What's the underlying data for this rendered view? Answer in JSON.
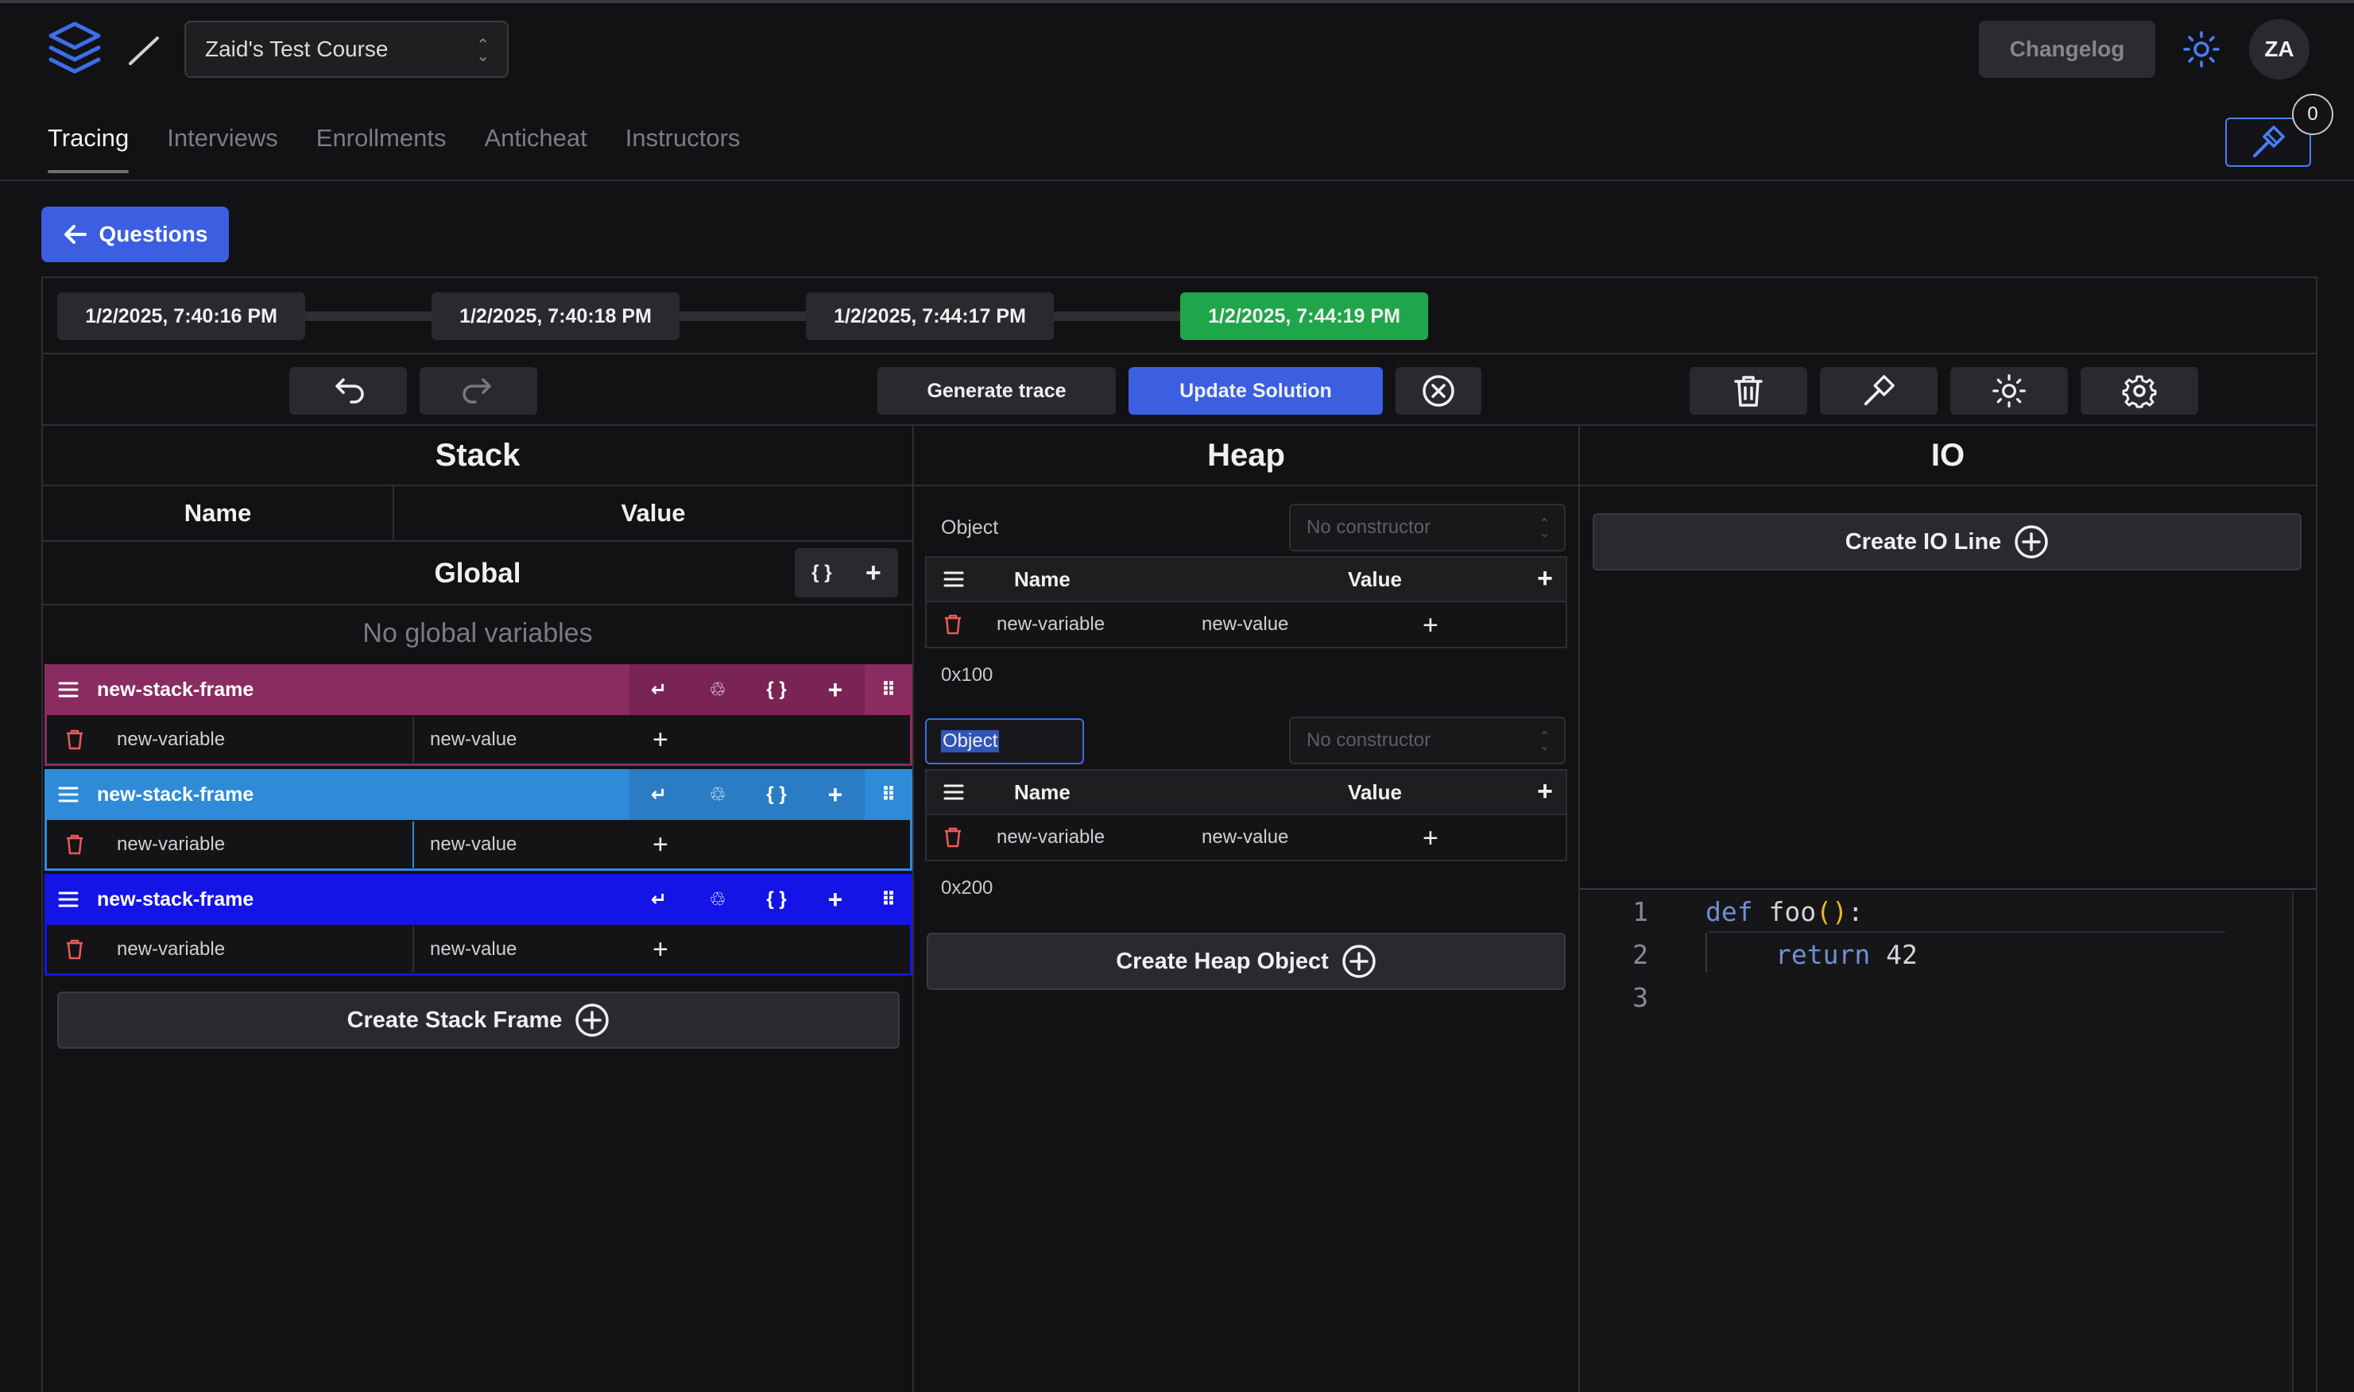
{
  "header": {
    "course_name": "Zaid's Test Course",
    "changelog_label": "Changelog",
    "avatar_initials": "ZA",
    "notification_count": "0"
  },
  "tabs": [
    {
      "label": "Tracing",
      "active": true
    },
    {
      "label": "Interviews",
      "active": false
    },
    {
      "label": "Enrollments",
      "active": false
    },
    {
      "label": "Anticheat",
      "active": false
    },
    {
      "label": "Instructors",
      "active": false
    }
  ],
  "questions_button": "Questions",
  "timeline": [
    "1/2/2025, 7:40:16 PM",
    "1/2/2025, 7:40:18 PM",
    "1/2/2025, 7:44:17 PM",
    "1/2/2025, 7:44:19 PM"
  ],
  "toolbar": {
    "generate_trace": "Generate trace",
    "update_solution": "Update Solution"
  },
  "stack": {
    "title": "Stack",
    "col_name": "Name",
    "col_value": "Value",
    "global_label": "Global",
    "braces": "{ }",
    "no_globals": "No global variables",
    "frames": [
      {
        "name": "new-stack-frame",
        "color": "#8a2c61",
        "var_name": "new-variable",
        "var_value": "new-value"
      },
      {
        "name": "new-stack-frame",
        "color": "#2f8ad8",
        "var_name": "new-variable",
        "var_value": "new-value"
      },
      {
        "name": "new-stack-frame",
        "color": "#1414e6",
        "var_name": "new-variable",
        "var_value": "new-value"
      }
    ],
    "create_label": "Create Stack Frame"
  },
  "heap": {
    "title": "Heap",
    "objects": [
      {
        "label": "Object",
        "constructor_placeholder": "No constructor",
        "col_name": "Name",
        "col_value": "Value",
        "var_name": "new-variable",
        "var_value": "new-value",
        "address": "0x100"
      },
      {
        "label": "Object",
        "constructor_placeholder": "No constructor",
        "col_name": "Name",
        "col_value": "Value",
        "var_name": "new-variable",
        "var_value": "new-value",
        "address": "0x200"
      }
    ],
    "create_label": "Create Heap Object"
  },
  "io": {
    "title": "IO",
    "create_label": "Create IO Line"
  },
  "code": {
    "line_numbers": [
      "1",
      "2",
      "3"
    ],
    "line1_kw": "def",
    "line1_name": " foo",
    "line1_parens": "()",
    "line1_colon": ":",
    "line2_kw": "return",
    "line2_num": " 42"
  },
  "colors": {
    "accent_blue": "#3b5fe0",
    "active_green": "#1fa64a",
    "frame_magenta": "#8a2c61",
    "frame_light_blue": "#2f8ad8",
    "frame_blue": "#1414e6"
  }
}
